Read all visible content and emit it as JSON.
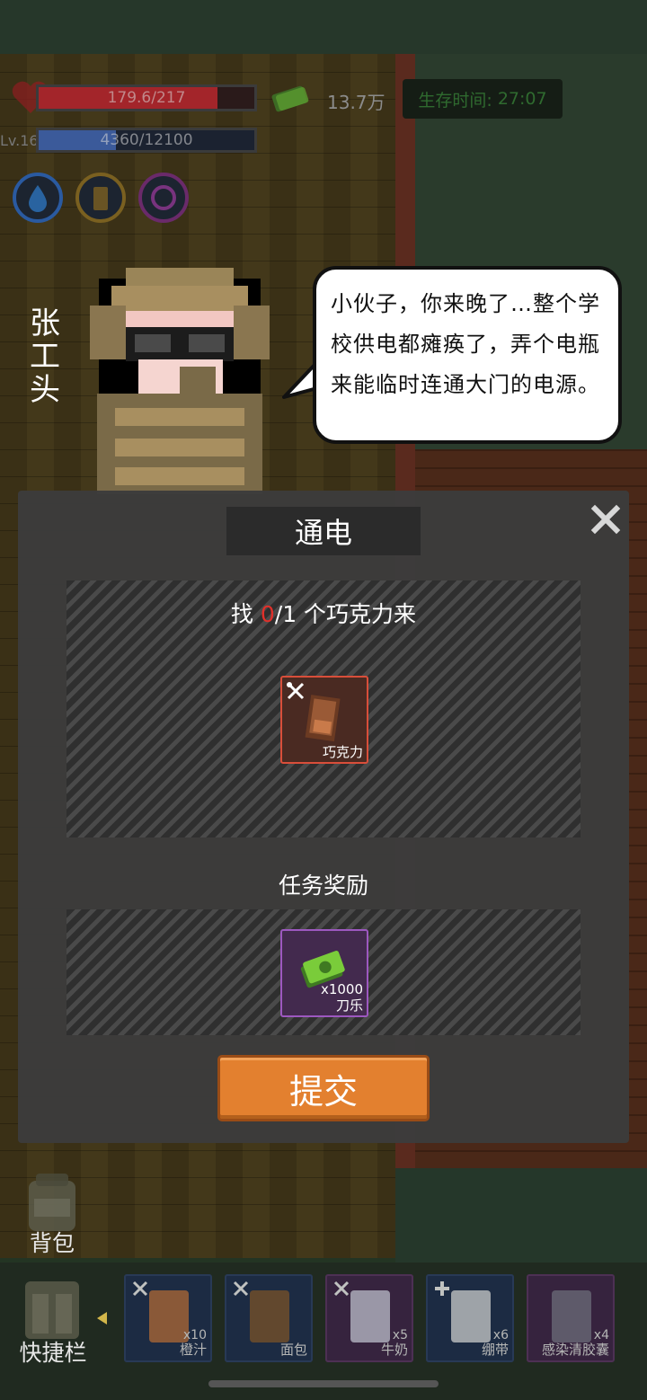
{
  "hud": {
    "hp_text": "179.6/217",
    "hp_fraction": 0.828,
    "level": "Lv.16",
    "xp_text": "4360/12100",
    "xp_fraction": 0.36,
    "money": "13.7万",
    "survival_label": "生存时间:",
    "survival_time": "27:07",
    "colors": {
      "hp": "#a3252a",
      "xp": "#3b5a9a",
      "survival": "#2f6a2f"
    }
  },
  "npc": {
    "name": "张工头",
    "dialog": "小伙子，你来晚了…整个学校供电都瘫痪了，弄个电瓶来能临时连通大门的电源。"
  },
  "quest": {
    "title": "通电",
    "task_prefix": "找 ",
    "task_current": "0",
    "task_suffix": "/1 个巧克力来",
    "required_item": {
      "name": "巧克力",
      "icon": "chocolate-icon"
    },
    "reward_title": "任务奖励",
    "reward_item": {
      "quantity": "x1000",
      "name": "刀乐",
      "icon": "cash-icon"
    },
    "submit_label": "提交",
    "close_icon": "close-icon"
  },
  "bottom": {
    "bag_label": "背包",
    "quickbar_label": "快捷栏",
    "hotbar": [
      {
        "name": "橙汁",
        "quantity": "x10",
        "icon": "orange-juice-icon",
        "corner": "wrench-icon"
      },
      {
        "name": "面包",
        "quantity": "",
        "icon": "bread-icon",
        "corner": "wrench-icon"
      },
      {
        "name": "牛奶",
        "quantity": "x5",
        "icon": "milk-icon",
        "corner": "wrench-icon"
      },
      {
        "name": "绷带",
        "quantity": "x6",
        "icon": "bandage-icon",
        "corner": "plus-icon"
      },
      {
        "name": "感染清胶囊",
        "quantity": "x4",
        "icon": "capsule-icon",
        "corner": ""
      }
    ]
  }
}
